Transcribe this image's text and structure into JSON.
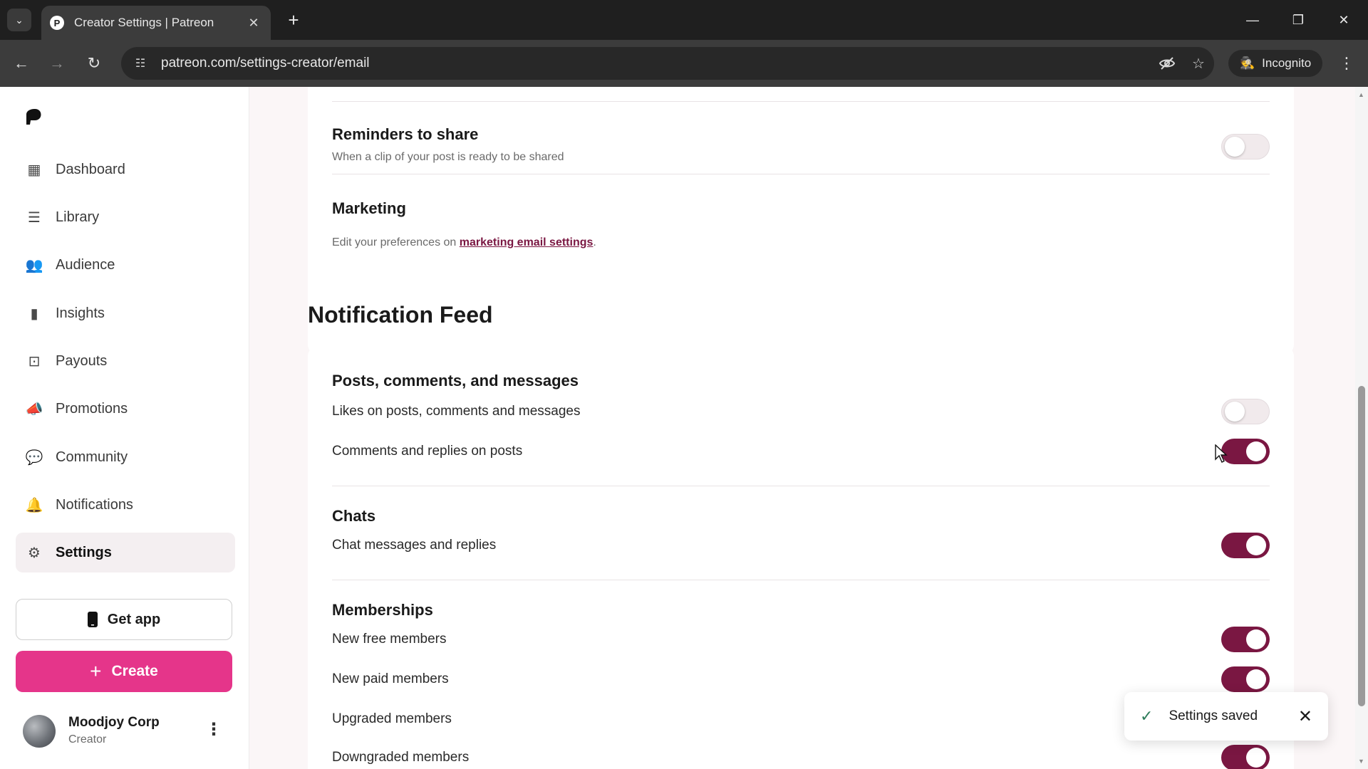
{
  "browser": {
    "tab_title": "Creator Settings | Patreon",
    "favicon_letter": "P",
    "url": "patreon.com/settings-creator/email",
    "incognito_label": "Incognito"
  },
  "sidebar": {
    "items": [
      {
        "label": "Dashboard",
        "icon": "dashboard-icon",
        "glyph": "▦"
      },
      {
        "label": "Library",
        "icon": "library-icon",
        "glyph": "☰"
      },
      {
        "label": "Audience",
        "icon": "audience-icon",
        "glyph": "👥"
      },
      {
        "label": "Insights",
        "icon": "insights-icon",
        "glyph": "▮"
      },
      {
        "label": "Payouts",
        "icon": "payouts-icon",
        "glyph": "⊡"
      },
      {
        "label": "Promotions",
        "icon": "promotions-icon",
        "glyph": "📣"
      },
      {
        "label": "Community",
        "icon": "community-icon",
        "glyph": "💬"
      },
      {
        "label": "Notifications",
        "icon": "bell-icon",
        "glyph": "🔔"
      },
      {
        "label": "Settings",
        "icon": "gear-icon",
        "glyph": "⚙"
      }
    ],
    "active_item": "Settings",
    "get_app_label": "Get app",
    "create_label": "Create",
    "user": {
      "name": "Moodjoy Corp",
      "role": "Creator"
    }
  },
  "email_section": {
    "reminders_title": "Reminders to share",
    "reminders_desc": "When a clip of your post is ready to be shared",
    "reminders_enabled": false,
    "marketing_title": "Marketing",
    "marketing_desc_prefix": "Edit your preferences on ",
    "marketing_link": "marketing email settings",
    "marketing_desc_suffix": "."
  },
  "notification_feed": {
    "title": "Notification Feed",
    "groups": [
      {
        "title": "Posts, comments, and messages",
        "rows": [
          {
            "label": "Likes on posts, comments and messages",
            "enabled": false
          },
          {
            "label": "Comments and replies on posts",
            "enabled": true
          }
        ]
      },
      {
        "title": "Chats",
        "rows": [
          {
            "label": "Chat messages and replies",
            "enabled": true
          }
        ]
      },
      {
        "title": "Memberships",
        "rows": [
          {
            "label": "New free members",
            "enabled": true
          },
          {
            "label": "New paid members",
            "enabled": true
          },
          {
            "label": "Upgraded members",
            "enabled": true
          },
          {
            "label": "Downgraded members",
            "enabled": true
          }
        ]
      }
    ]
  },
  "toast": {
    "message": "Settings saved"
  },
  "colors": {
    "brand_pink": "#e5358a",
    "toggle_on": "#7a1742",
    "link": "#7a1742"
  }
}
